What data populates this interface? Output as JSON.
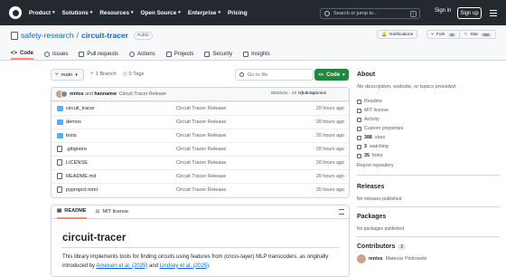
{
  "topnav": {
    "items": [
      "Product",
      "Solutions",
      "Resources",
      "Open Source",
      "Enterprise",
      "Pricing"
    ],
    "search_placeholder": "Search or jump to...",
    "search_key": "/",
    "signin": "Sign in",
    "signup": "Sign up"
  },
  "repo": {
    "owner": "safety-research",
    "separator": "/",
    "name": "circuit-tracer",
    "visibility": "Public",
    "notifications": "Notifications",
    "fork_label": "Fork",
    "fork_count": "35",
    "star_label": "Star",
    "star_count": "388"
  },
  "tabs": [
    "Code",
    "Issues",
    "Pull requests",
    "Actions",
    "Projects",
    "Security",
    "Insights"
  ],
  "toolbar": {
    "branch": "main",
    "branches": "1 Branch",
    "tags": "0 Tags",
    "gofile_placeholder": "Go to file",
    "code_button": "Code"
  },
  "commit": {
    "author1": "mntss",
    "and": "and",
    "author2": "hannamw",
    "message": "Circuit Tracer Release",
    "sha": "8b6d10e · 20 hours ago",
    "commits": "5 Commits"
  },
  "files": [
    {
      "name": "circuit_tracer",
      "type": "dir",
      "message": "Circuit Tracer Release",
      "age": "20 hours ago"
    },
    {
      "name": "demos",
      "type": "dir",
      "message": "Circuit Tracer Release",
      "age": "20 hours ago"
    },
    {
      "name": "tests",
      "type": "dir",
      "message": "Circuit Tracer Release",
      "age": "20 hours ago"
    },
    {
      "name": ".gitignore",
      "type": "file",
      "message": "Circuit Tracer Release",
      "age": "20 hours ago"
    },
    {
      "name": "LICENSE",
      "type": "file",
      "message": "Circuit Tracer Release",
      "age": "20 hours ago"
    },
    {
      "name": "README.md",
      "type": "file",
      "message": "Circuit Tracer Release",
      "age": "20 hours ago"
    },
    {
      "name": "pyproject.toml",
      "type": "file",
      "message": "Circuit Tracer Release",
      "age": "20 hours ago"
    }
  ],
  "readme": {
    "tab_readme": "README",
    "tab_license": "MIT license",
    "title": "circuit-tracer",
    "para_before": "This library implements tools for finding circuits using features from (cross-layer) MLP transcoders, as originally introduced by ",
    "link1": "Ameisen et al. (2025)",
    "and": " and ",
    "link2": "Lindsey et al. (2025)",
    "para_after": "."
  },
  "sidebar": {
    "about": "About",
    "description": "No description, website, or topics provided.",
    "readme": "Readme",
    "license": "MIT license",
    "activity": "Activity",
    "custom_properties": "Custom properties",
    "stars_count": "388",
    "stars_label": "stars",
    "watching_count": "3",
    "watching_label": "watching",
    "forks_count": "35",
    "forks_label": "forks",
    "report": "Report repository",
    "releases": "Releases",
    "no_releases": "No releases published",
    "packages": "Packages",
    "no_packages": "No packages published",
    "contributors": "Contributors",
    "contributors_count": "2",
    "contributor_login": "mntss",
    "contributor_name": "Mateusz Piotrowski"
  },
  "colors": {
    "accent": "#0969da",
    "header": "#24292f",
    "code_button": "#1f883d",
    "tab_underline": "#fd8c73",
    "folder": "#54aeff"
  }
}
